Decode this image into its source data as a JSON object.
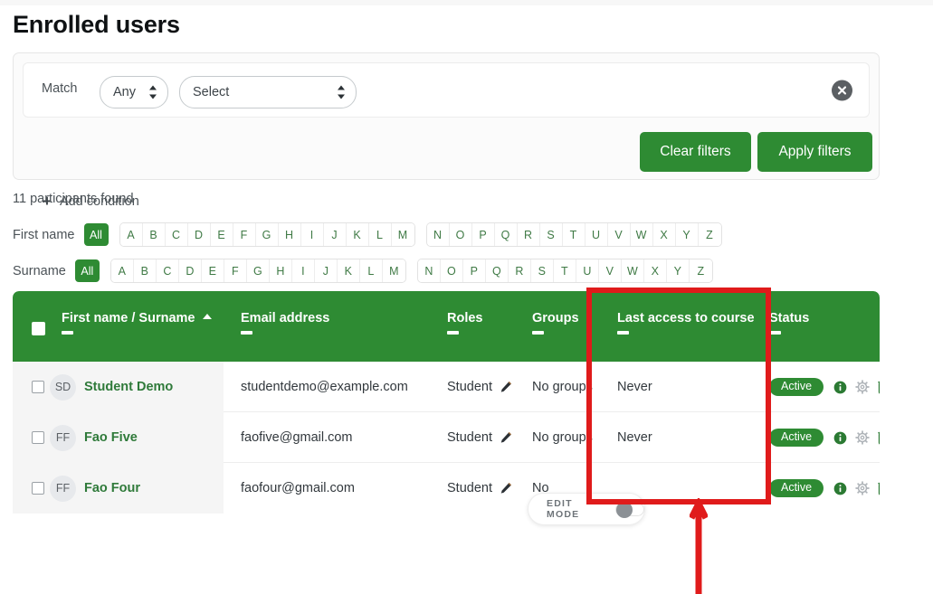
{
  "page": {
    "title": "Enrolled users"
  },
  "filter": {
    "match_label": "Match",
    "match_value": "Any",
    "condition_value": "Select",
    "clear_condition_icon": "close-circle-icon",
    "add_condition_label": "Add condition",
    "add_condition_icon": "plus-icon",
    "clear_filters_label": "Clear filters",
    "apply_filters_label": "Apply filters",
    "button_color": "#2e8b33"
  },
  "results": {
    "count_text": "11 participants found"
  },
  "alpha": {
    "first_name_label": "First name",
    "surname_label": "Surname",
    "all_label": "All",
    "group_one": [
      "A",
      "B",
      "C",
      "D",
      "E",
      "F",
      "G",
      "H",
      "I",
      "J",
      "K",
      "L",
      "M"
    ],
    "group_two": [
      "N",
      "O",
      "P",
      "Q",
      "R",
      "S",
      "T",
      "U",
      "V",
      "W",
      "X",
      "Y",
      "Z"
    ]
  },
  "table": {
    "header_bg": "#2e8b33",
    "columns": [
      {
        "label": "First name / Surname",
        "sorted": true,
        "sort_dir": "asc"
      },
      {
        "label": "Email address",
        "sorted": false
      },
      {
        "label": "Roles",
        "sorted": false
      },
      {
        "label": "Groups",
        "sorted": false
      },
      {
        "label": "Last access to course",
        "sorted": false
      },
      {
        "label": "Status",
        "sorted": false
      }
    ],
    "rows": [
      {
        "initials": "SD",
        "name": "Student Demo",
        "email": "studentdemo@example.com",
        "role": "Student",
        "groups": "No groups",
        "last_access": "Never",
        "status": "Active"
      },
      {
        "initials": "FF",
        "name": "Fao Five",
        "email": "faofive@gmail.com",
        "role": "Student",
        "groups": "No groups",
        "last_access": "Never",
        "status": "Active"
      },
      {
        "initials": "FF",
        "name": "Fao Four",
        "email": "faofour@gmail.com",
        "role": "Student",
        "groups": "No",
        "last_access": "",
        "status": "Active"
      }
    ],
    "row_icons": {
      "edit_role": "pencil-icon",
      "info": "info-icon",
      "settings": "gear-icon",
      "delete": "trash-icon"
    }
  },
  "edit_mode": {
    "label": "EDIT MODE",
    "enabled": false
  },
  "annotation": {
    "color": "#e01b1b",
    "box_target": "Last access to course",
    "arrow_direction": "up"
  }
}
